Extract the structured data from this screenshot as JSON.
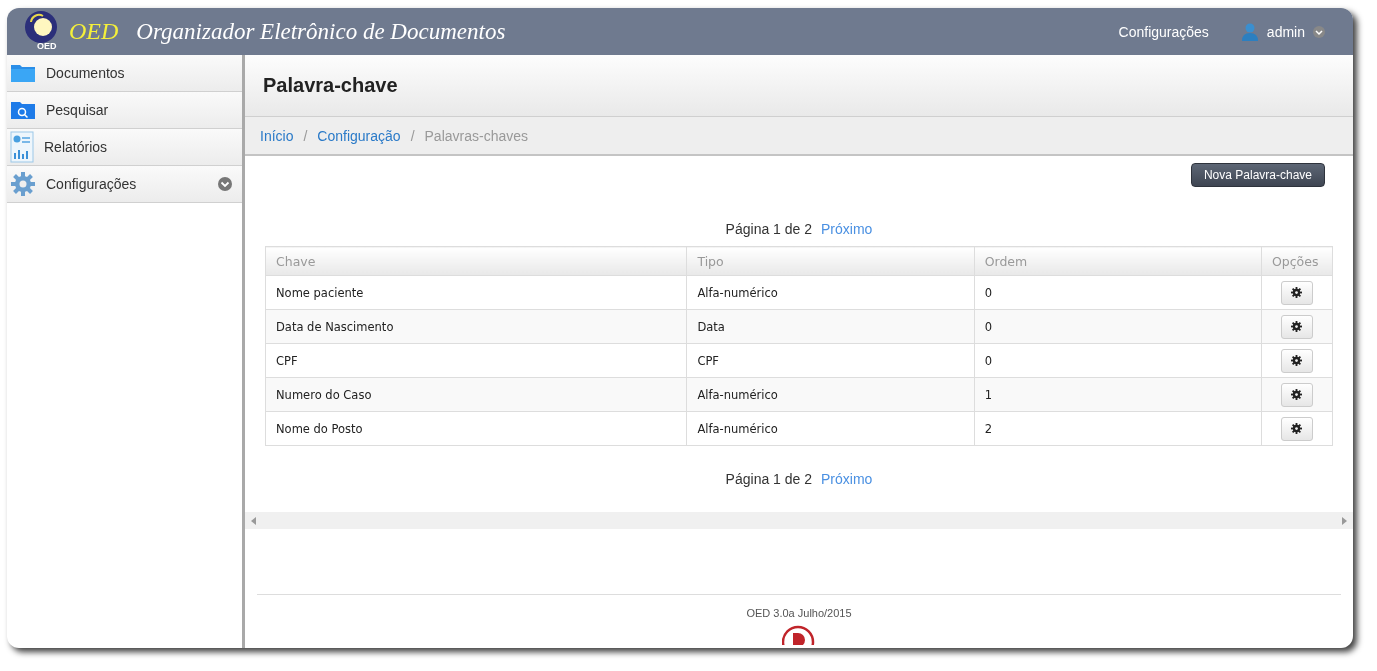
{
  "header": {
    "logo_caption": "OED",
    "brand": "OED",
    "title": "Organizador Eletrônico de Documentos",
    "nav": "Configurações",
    "user": "admin"
  },
  "sidebar": {
    "items": [
      {
        "label": "Documentos",
        "kind": "folder",
        "has_submenu": false
      },
      {
        "label": "Pesquisar",
        "kind": "search",
        "has_submenu": false
      },
      {
        "label": "Relatórios",
        "kind": "report",
        "has_submenu": false
      },
      {
        "label": "Configurações",
        "kind": "gear",
        "has_submenu": true
      }
    ]
  },
  "page_title": "Palavra-chave",
  "breadcrumb_separator": "/",
  "breadcrumb": [
    {
      "label": "Início",
      "current": false
    },
    {
      "label": "Configuração",
      "current": false
    },
    {
      "label": "Palavras-chaves",
      "current": true
    }
  ],
  "new_button": "Nova Palavra-chave",
  "pagination_top": {
    "text": "Página 1 de 2",
    "next": "Próximo"
  },
  "table": {
    "columns": [
      "Chave",
      "Tipo",
      "Ordem",
      "Opções"
    ],
    "rows": [
      {
        "chave": "Nome paciente",
        "tipo": "Alfa-numérico",
        "ordem": "0"
      },
      {
        "chave": "Data de Nascimento",
        "tipo": "Data",
        "ordem": "0"
      },
      {
        "chave": "CPF",
        "tipo": "CPF",
        "ordem": "0"
      },
      {
        "chave": "Numero do Caso",
        "tipo": "Alfa-numérico",
        "ordem": "1"
      },
      {
        "chave": "Nome do Posto",
        "tipo": "Alfa-numérico",
        "ordem": "2"
      }
    ]
  },
  "pagination_bottom": {
    "text": "Página 1 de 2",
    "next": "Próximo"
  },
  "footer": "OED 3.0a Julho/2015"
}
